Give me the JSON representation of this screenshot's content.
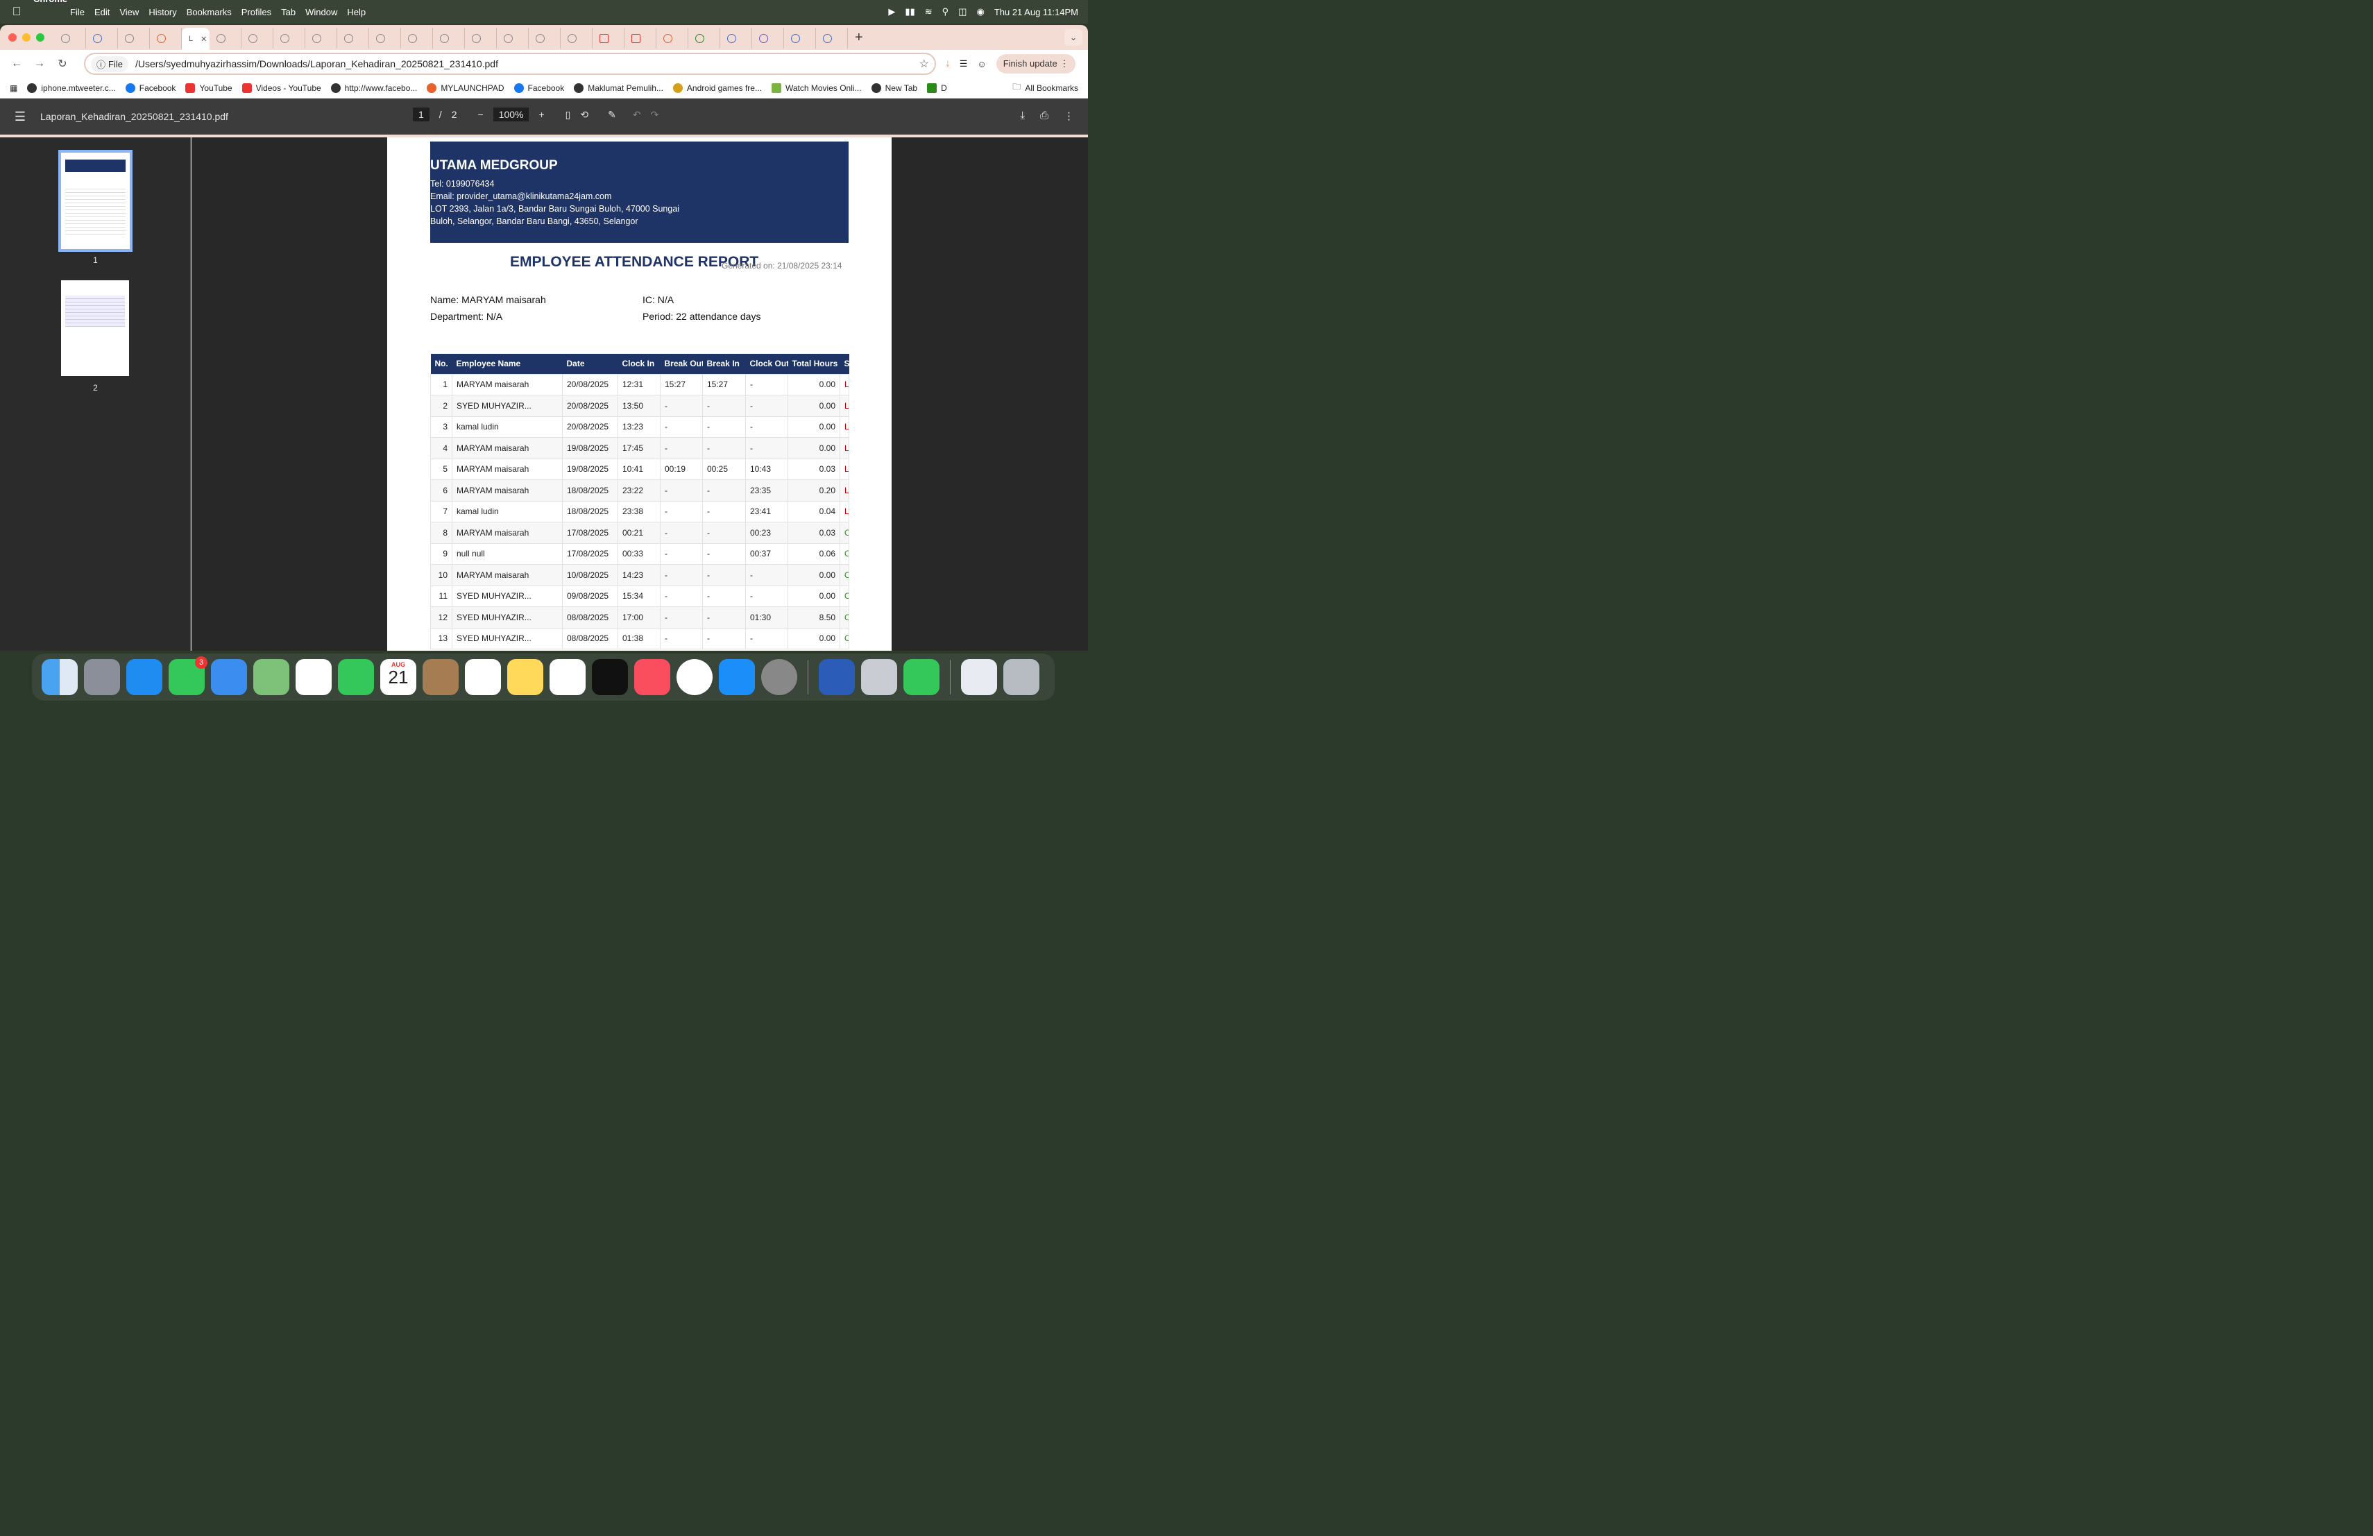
{
  "menubar": {
    "app_name": "Chrome",
    "items": [
      "File",
      "Edit",
      "View",
      "History",
      "Bookmarks",
      "Profiles",
      "Tab",
      "Window",
      "Help"
    ],
    "datetime": "Thu 21 Aug  11:14PM"
  },
  "browser": {
    "active_tab_title": "L",
    "address_chip": "File",
    "url": "/Users/syedmuhyazirhassim/Downloads/Laporan_Kehadiran_20250821_231410.pdf",
    "update_button": "Finish update",
    "bookmarks": [
      "iphone.mtweeter.c...",
      "Facebook",
      "YouTube",
      "Videos - YouTube",
      "http://www.facebo...",
      "MYLAUNCHPAD",
      "Facebook",
      "Maklumat Pemulih...",
      "Android games fre...",
      "Watch Movies Onli...",
      "New Tab",
      "D"
    ],
    "all_bookmarks": "All Bookmarks"
  },
  "pdf_viewer": {
    "file_name": "Laporan_Kehadiran_20250821_231410.pdf",
    "current_page": "1",
    "page_separator": "/",
    "total_pages": "2",
    "zoom": "100%",
    "thumb_labels": [
      "1",
      "2"
    ]
  },
  "report": {
    "company": "UTAMA MEDGROUP",
    "tel": "Tel: 0199076434",
    "email": "Email: provider_utama@klinikutama24jam.com",
    "address_line1": "LOT 2393, Jalan 1a/3, Bandar Baru Sungai Buloh, 47000 Sungai",
    "address_line2": "Buloh, Selangor, Bandar Baru Bangi, 43650, Selangor",
    "title": "EMPLOYEE ATTENDANCE REPORT",
    "generated": "Generated on: 21/08/2025 23:14",
    "name": "Name: MARYAM maisarah",
    "ic": "IC: N/A",
    "department": "Department: N/A",
    "period": "Period: 22 attendance days",
    "columns": [
      "No.",
      "Employee Name",
      "Date",
      "Clock In",
      "Break Out",
      "Break In",
      "Clock Out",
      "Total Hours",
      "St"
    ],
    "rows": [
      [
        "1",
        "MARYAM maisarah",
        "20/08/2025",
        "12:31",
        "15:27",
        "15:27",
        "-",
        "0.00",
        "Late"
      ],
      [
        "2",
        "SYED MUHYAZIR...",
        "20/08/2025",
        "13:50",
        "-",
        "-",
        "-",
        "0.00",
        "Late"
      ],
      [
        "3",
        "kamal ludin",
        "20/08/2025",
        "13:23",
        "-",
        "-",
        "-",
        "0.00",
        "Late"
      ],
      [
        "4",
        "MARYAM maisarah",
        "19/08/2025",
        "17:45",
        "-",
        "-",
        "-",
        "0.00",
        "Late"
      ],
      [
        "5",
        "MARYAM maisarah",
        "19/08/2025",
        "10:41",
        "00:19",
        "00:25",
        "10:43",
        "0.03",
        "Late"
      ],
      [
        "6",
        "MARYAM maisarah",
        "18/08/2025",
        "23:22",
        "-",
        "-",
        "23:35",
        "0.20",
        "Late"
      ],
      [
        "7",
        "kamal ludin",
        "18/08/2025",
        "23:38",
        "-",
        "-",
        "23:41",
        "0.04",
        "Late"
      ],
      [
        "8",
        "MARYAM maisarah",
        "17/08/2025",
        "00:21",
        "-",
        "-",
        "00:23",
        "0.03",
        "On Time"
      ],
      [
        "9",
        "null null",
        "17/08/2025",
        "00:33",
        "-",
        "-",
        "00:37",
        "0.06",
        "On Time"
      ],
      [
        "10",
        "MARYAM maisarah",
        "10/08/2025",
        "14:23",
        "-",
        "-",
        "-",
        "0.00",
        "On Time"
      ],
      [
        "11",
        "SYED MUHYAZIR...",
        "09/08/2025",
        "15:34",
        "-",
        "-",
        "-",
        "0.00",
        "On Time"
      ],
      [
        "12",
        "SYED MUHYAZIR...",
        "08/08/2025",
        "17:00",
        "-",
        "-",
        "01:30",
        "8.50",
        "On Time"
      ],
      [
        "13",
        "SYED MUHYAZIR...",
        "08/08/2025",
        "01:38",
        "-",
        "-",
        "-",
        "0.00",
        "On Time"
      ]
    ]
  },
  "dock": {
    "messages_badge": "3",
    "calendar_month": "AUG",
    "calendar_day": "21"
  },
  "colors": {
    "header_navy": "#1f3466",
    "late": "#c00000",
    "on_time": "#2a8a1a"
  }
}
